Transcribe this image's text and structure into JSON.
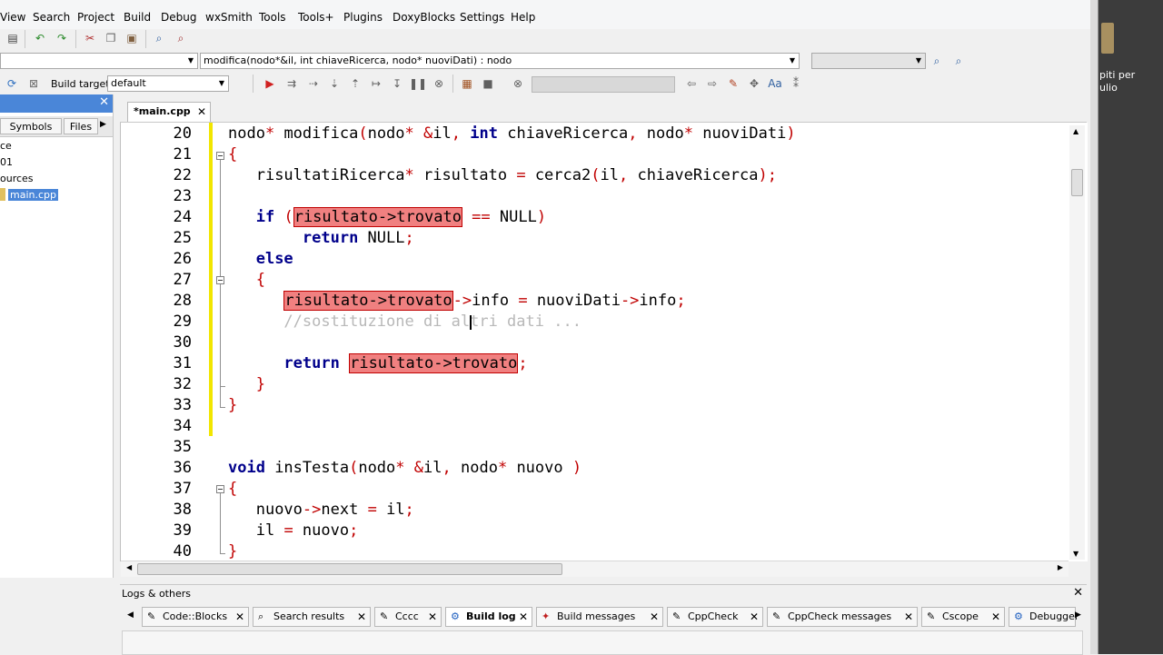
{
  "menu": [
    "View",
    "Search",
    "Project",
    "Build",
    "Debug",
    "wxSmith",
    "Tools",
    "Tools+",
    "Plugins",
    "DoxyBlocks",
    "Settings",
    "Help"
  ],
  "toolbar": {
    "function_combo": "modifica(nodo*&il, int chiaveRicerca, nodo* nuoviDati) : nodo",
    "build_target_label": "Build target:",
    "build_target_value": "default"
  },
  "left_panel": {
    "tabs": [
      "Symbols",
      "Files"
    ],
    "tree": [
      "ce",
      "01",
      "ources",
      "main.cpp"
    ]
  },
  "editor": {
    "tab_label": "*main.cpp",
    "lines": [
      {
        "n": "20"
      },
      {
        "n": "21"
      },
      {
        "n": "22"
      },
      {
        "n": "23"
      },
      {
        "n": "24"
      },
      {
        "n": "25"
      },
      {
        "n": "26"
      },
      {
        "n": "27"
      },
      {
        "n": "28"
      },
      {
        "n": "29"
      },
      {
        "n": "30"
      },
      {
        "n": "31"
      },
      {
        "n": "32"
      },
      {
        "n": "33"
      },
      {
        "n": "34"
      },
      {
        "n": "35"
      },
      {
        "n": "36"
      },
      {
        "n": "37"
      },
      {
        "n": "38"
      },
      {
        "n": "39"
      },
      {
        "n": "40"
      }
    ],
    "code": {
      "l20_a": "nodo",
      "l20_b": "*",
      "l20_c": " modifica",
      "l20_d": "(",
      "l20_e": "nodo",
      "l20_f": "*",
      "l20_g": " ",
      "l20_h": "&",
      "l20_i": "il",
      "l20_j": ",",
      "l20_k": " ",
      "l20_kw": "int",
      "l20_l": " chiaveRicerca",
      "l20_m": ",",
      "l20_n": " nodo",
      "l20_o": "*",
      "l20_p": " nuoviDati",
      "l20_q": ")",
      "l21": "{",
      "l22_a": "risultatiRicerca",
      "l22_b": "*",
      "l22_c": " risultato ",
      "l22_d": "=",
      "l22_e": " cerca2",
      "l22_f": "(",
      "l22_g": "il",
      "l22_h": ",",
      "l22_i": " chiaveRicerca",
      "l22_j": ");",
      "l24_kw": "if",
      "l24_a": "(",
      "l24_hl": "risultato->trovato",
      "l24_b": " ==",
      "l24_c": " NULL",
      "l24_d": ")",
      "l25_kw": "return",
      "l25_a": " NULL",
      "l25_b": ";",
      "l26_kw": "else",
      "l27": "{",
      "l28_hl": "risultato->trovato",
      "l28_a": "->",
      "l28_b": "info ",
      "l28_c": "=",
      "l28_d": " nuoviDati",
      "l28_e": "->",
      "l28_f": "info",
      "l28_g": ";",
      "l29": "//sostituzione di altri dati ...",
      "l31_kw": "return",
      "l31_hl": "risultato->trovato",
      "l31_a": ";",
      "l32": "}",
      "l33": "}",
      "l36_kw": "void",
      "l36_a": " insTesta",
      "l36_b": "(",
      "l36_c": "nodo",
      "l36_d": "*",
      "l36_e": " ",
      "l36_f": "&",
      "l36_g": "il",
      "l36_h": ",",
      "l36_i": " nodo",
      "l36_j": "*",
      "l36_k": " nuovo ",
      "l36_l": ")",
      "l37": "{",
      "l38_a": "nuovo",
      "l38_b": "->",
      "l38_c": "next ",
      "l38_d": "=",
      "l38_e": " il",
      "l38_f": ";",
      "l39_a": "il ",
      "l39_b": "=",
      "l39_c": " nuovo",
      "l39_d": ";",
      "l40": "}"
    }
  },
  "logs": {
    "title": "Logs & others",
    "tabs": [
      "Code::Blocks",
      "Search results",
      "Cccc",
      "Build log",
      "Build messages",
      "CppCheck",
      "CppCheck messages",
      "Cscope",
      "Debugger"
    ],
    "active_tab": "Build log"
  },
  "desktop": {
    "label_line1": "piti per",
    "label_line2": "ulio"
  },
  "colors": {
    "keyword": "#00008b",
    "operator": "#c00000",
    "highlight": "#f08080",
    "change_bar": "#f2e600",
    "comment": "#b8b8b8"
  }
}
